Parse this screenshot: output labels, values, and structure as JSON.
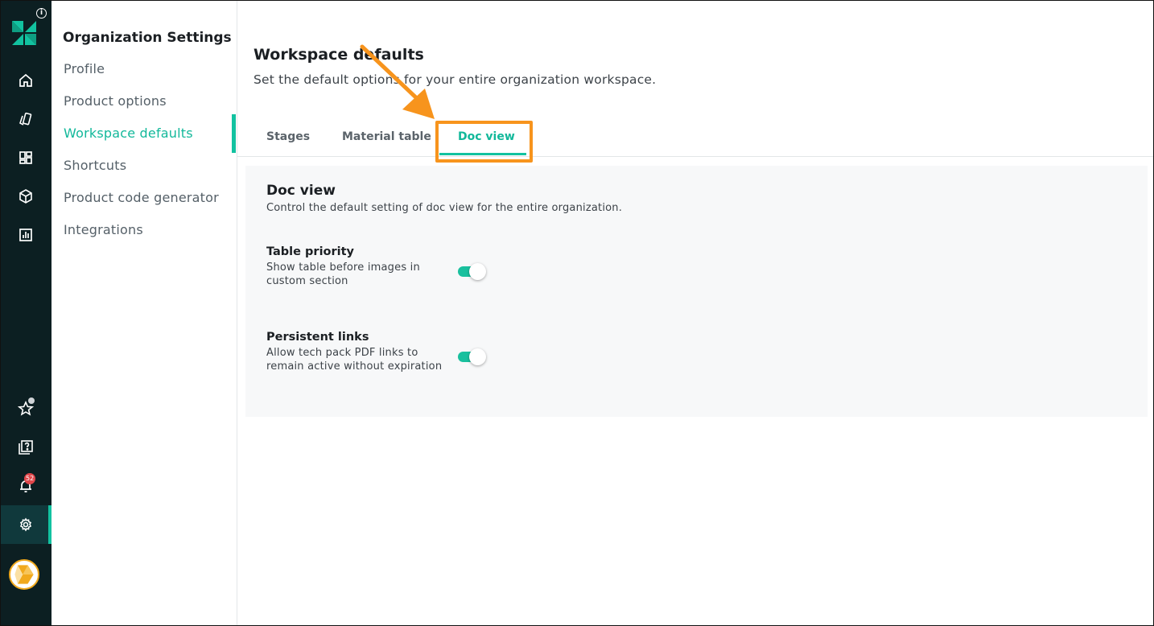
{
  "rail": {
    "notifications_count": "52",
    "items": [
      "home-icon",
      "catalog-icon",
      "dashboard-icon",
      "box-icon",
      "report-icon",
      "star-icon",
      "help-icon",
      "bell-icon",
      "gear-icon"
    ]
  },
  "settings_nav": {
    "title": "Organization Settings",
    "items": [
      {
        "label": "Profile"
      },
      {
        "label": "Product options"
      },
      {
        "label": "Workspace defaults",
        "active": true
      },
      {
        "label": "Shortcuts"
      },
      {
        "label": "Product code generator"
      },
      {
        "label": "Integrations"
      }
    ]
  },
  "page": {
    "title": "Workspace defaults",
    "subtitle": "Set the default options for your entire organization workspace."
  },
  "tabs": [
    {
      "label": "Stages"
    },
    {
      "label": "Material table"
    },
    {
      "label": "Doc view",
      "active": true
    }
  ],
  "doc_view": {
    "title": "Doc view",
    "subtitle": "Control the default setting of doc view for the entire organization.",
    "settings": [
      {
        "label": "Table priority",
        "description": "Show table before images in custom section",
        "enabled": true
      },
      {
        "label": "Persistent links",
        "description": "Allow tech pack PDF links to remain active without expiration",
        "enabled": true
      }
    ]
  },
  "colors": {
    "rail_bg": "#0c1f22",
    "accent": "#12c2a0",
    "highlight": "#f7941d",
    "badge": "#e0474b"
  }
}
